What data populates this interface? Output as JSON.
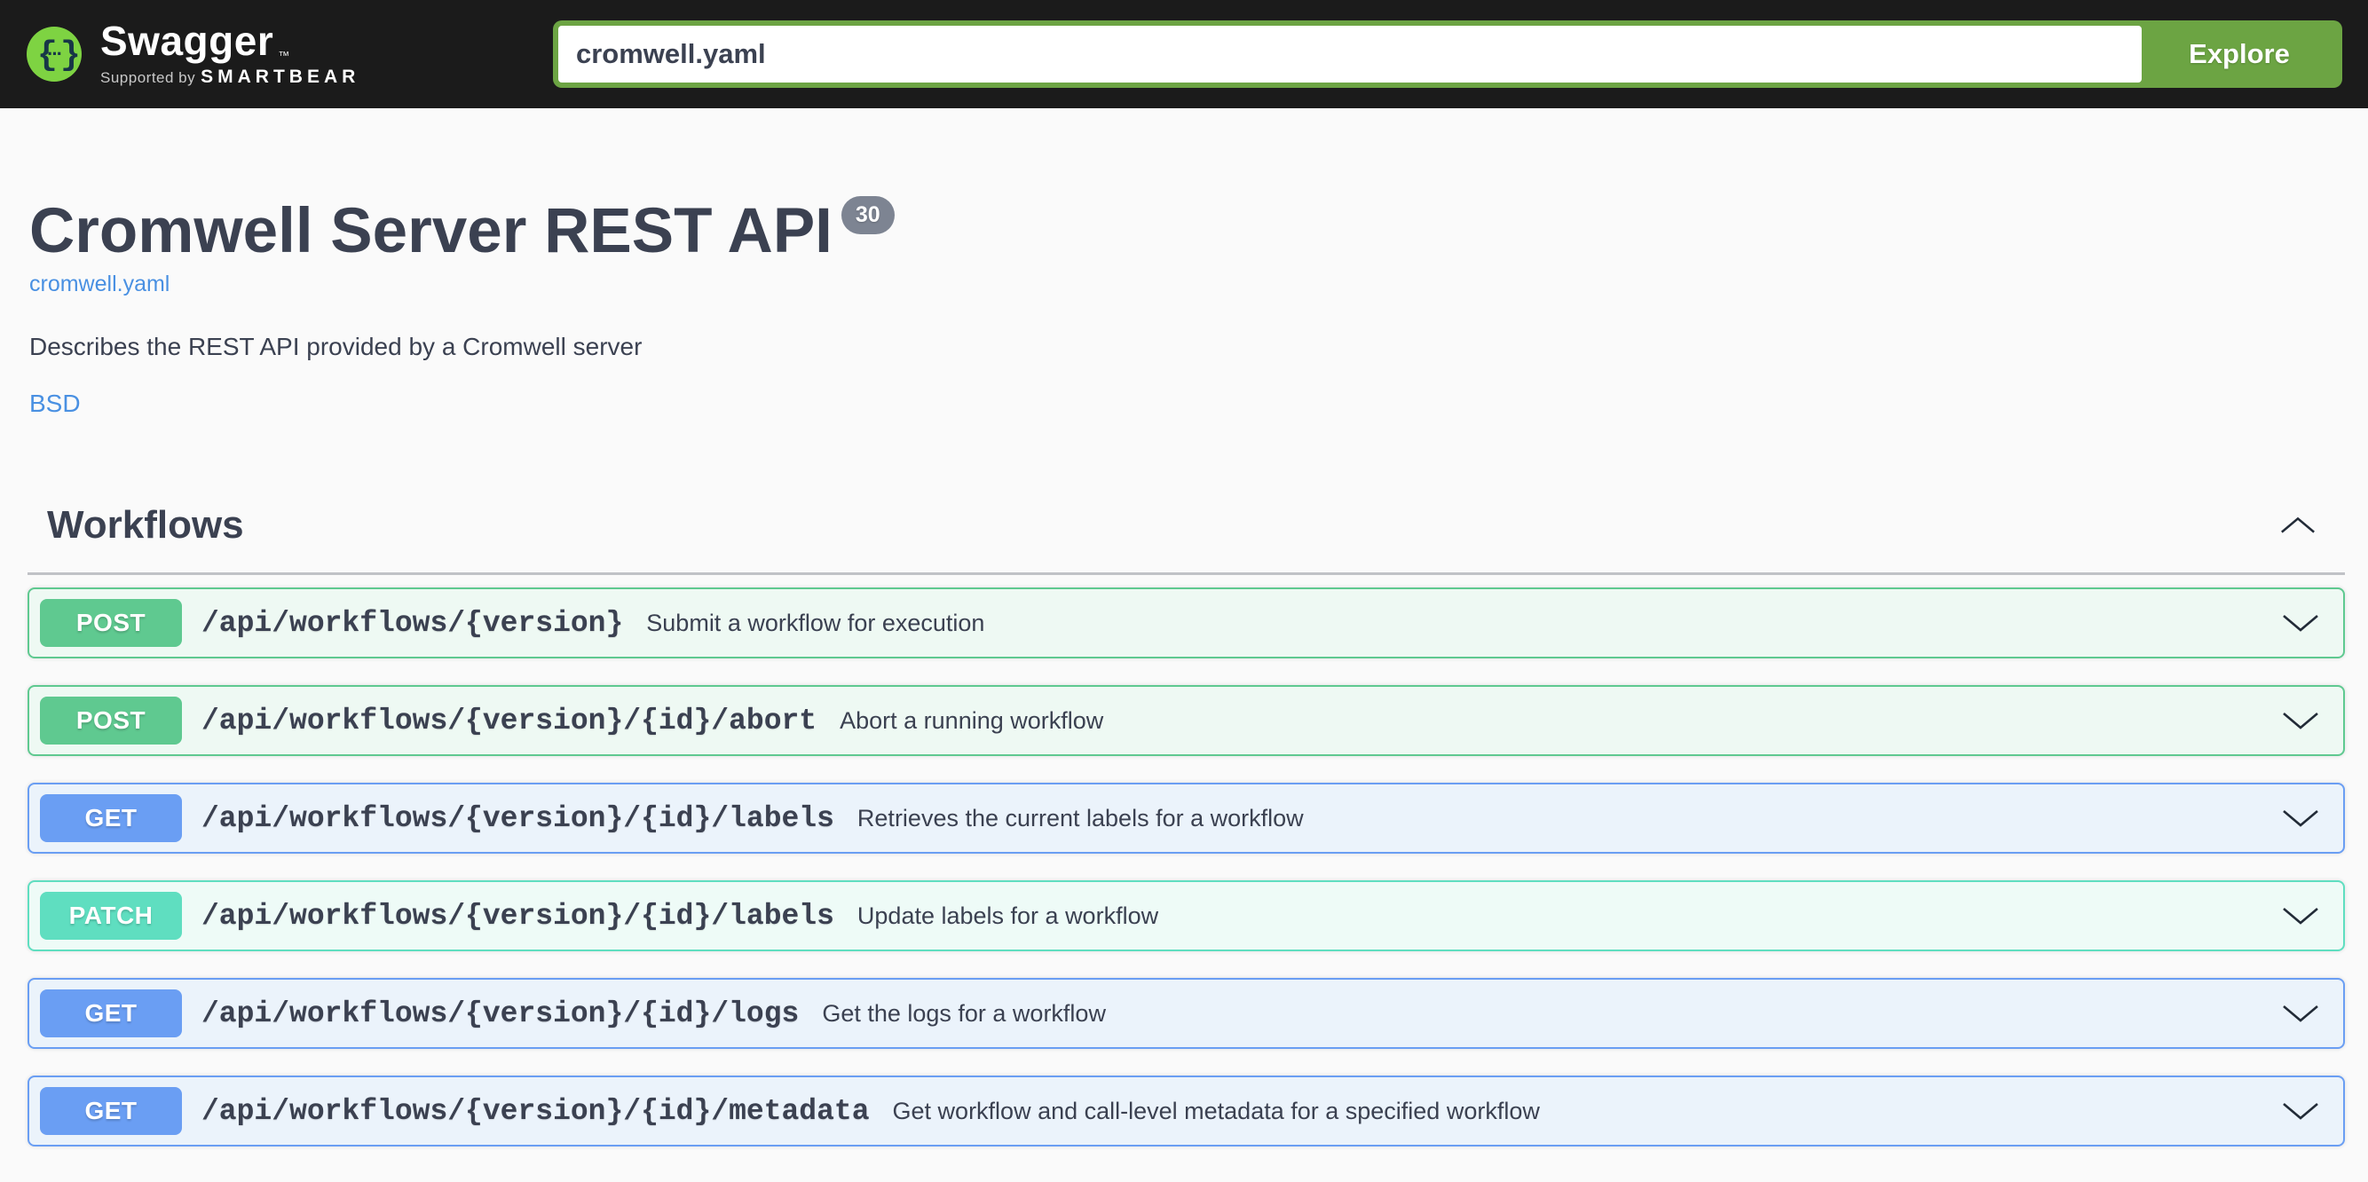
{
  "topbar": {
    "brand": "Swagger",
    "brand_tm": "™",
    "supported_by_prefix": "Supported by",
    "supported_by_brand": "SMARTBEAR",
    "search_value": "cromwell.yaml",
    "explore_label": "Explore"
  },
  "info": {
    "title": "Cromwell Server REST API",
    "version_badge": "30",
    "spec_link": "cromwell.yaml",
    "description": "Describes the REST API provided by a Cromwell server",
    "license_link": "BSD"
  },
  "section": {
    "title": "Workflows"
  },
  "endpoints": [
    {
      "method": "POST",
      "theme": "post",
      "path": "/api/workflows/{version}",
      "summary": "Submit a workflow for execution"
    },
    {
      "method": "POST",
      "theme": "post",
      "path": "/api/workflows/{version}/{id}/abort",
      "summary": "Abort a running workflow"
    },
    {
      "method": "GET",
      "theme": "get",
      "path": "/api/workflows/{version}/{id}/labels",
      "summary": "Retrieves the current labels for a workflow"
    },
    {
      "method": "PATCH",
      "theme": "patch",
      "path": "/api/workflows/{version}/{id}/labels",
      "summary": "Update labels for a workflow"
    },
    {
      "method": "GET",
      "theme": "get",
      "path": "/api/workflows/{version}/{id}/logs",
      "summary": "Get the logs for a workflow"
    },
    {
      "method": "GET",
      "theme": "get",
      "path": "/api/workflows/{version}/{id}/metadata",
      "summary": "Get workflow and call-level metadata for a specified workflow"
    }
  ],
  "colors": {
    "topbar_bg": "#1b1b1b",
    "explore_green": "#6ca443",
    "logo_green": "#7ed342",
    "logo_braces": "#173647",
    "link_blue": "#4990e2",
    "text_dark": "#3b4151",
    "version_badge_bg": "#7d8492",
    "methods": {
      "post": {
        "accent": "#5fc990",
        "bg": "#eef9f3"
      },
      "get": {
        "accent": "#6a9ef3",
        "bg": "#ebf3fb"
      },
      "patch": {
        "accent": "#5fdec0",
        "bg": "#eefbf7"
      }
    }
  }
}
